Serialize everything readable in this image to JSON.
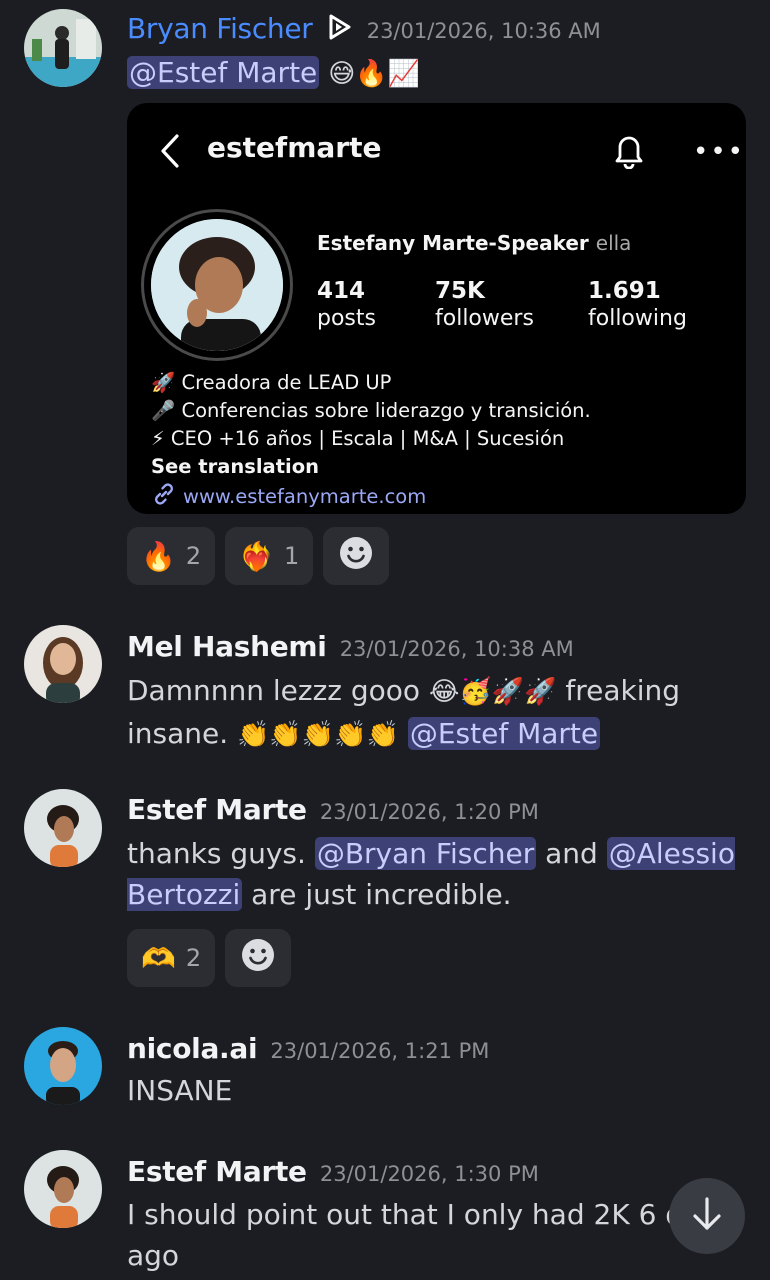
{
  "messages": [
    {
      "author": "Bryan Fischer",
      "timestamp": "23/01/2026, 10:36 AM",
      "mention": "@Estef Marte",
      "emojis": "😅🔥📈",
      "embed": {
        "username": "estefmarte",
        "full_name": "Estefany Marte-Speaker",
        "pronoun": "ella",
        "posts_count": "414",
        "posts_label": "posts",
        "followers_count": "75K",
        "followers_label": "followers",
        "following_count": "1.691",
        "following_label": "following",
        "bio_line1": "🚀 Creadora de LEAD UP",
        "bio_line2": "🎤 Conferencias sobre liderazgo y transición.",
        "bio_line3": "⚡ CEO +16 años | Escala | M&A | Sucesión",
        "see_translation": "See translation",
        "link": "www.estefanymarte.com"
      },
      "reactions": [
        {
          "emoji": "🔥",
          "count": "2"
        },
        {
          "emoji": "❤️‍🔥",
          "count": "1"
        }
      ]
    },
    {
      "author": "Mel Hashemi",
      "timestamp": "23/01/2026, 10:38 AM",
      "text_a": "Damnnnn lezzz gooo ",
      "emojis_a": "😂🥳🚀🚀",
      "text_b": " freaking insane. ",
      "emojis_b": "👏👏👏👏👏",
      "mention": "@Estef Marte"
    },
    {
      "author": "Estef Marte",
      "timestamp": "23/01/2026, 1:20 PM",
      "text_a": "thanks guys. ",
      "mention_a": "@Bryan Fischer",
      "text_b": " and ",
      "mention_b": "@Alessio Bertozzi",
      "text_c": " are just incredible.",
      "reactions": [
        {
          "emoji": "🫶",
          "count": "2"
        }
      ]
    },
    {
      "author": "nicola.ai",
      "timestamp": "23/01/2026, 1:21 PM",
      "text": "INSANE"
    },
    {
      "author": "Estef Marte",
      "timestamp": "23/01/2026, 1:30 PM",
      "text": "I should point out that I only had 2K 6 days ago"
    }
  ],
  "icons": {
    "play_badge": "play-badge-icon",
    "add_reaction": "smiley-icon",
    "scroll_down": "arrow-down-icon"
  },
  "colors": {
    "background": "#1c1d22",
    "mention_bg": "#3d4176",
    "accent_author": "#4a8cff"
  }
}
